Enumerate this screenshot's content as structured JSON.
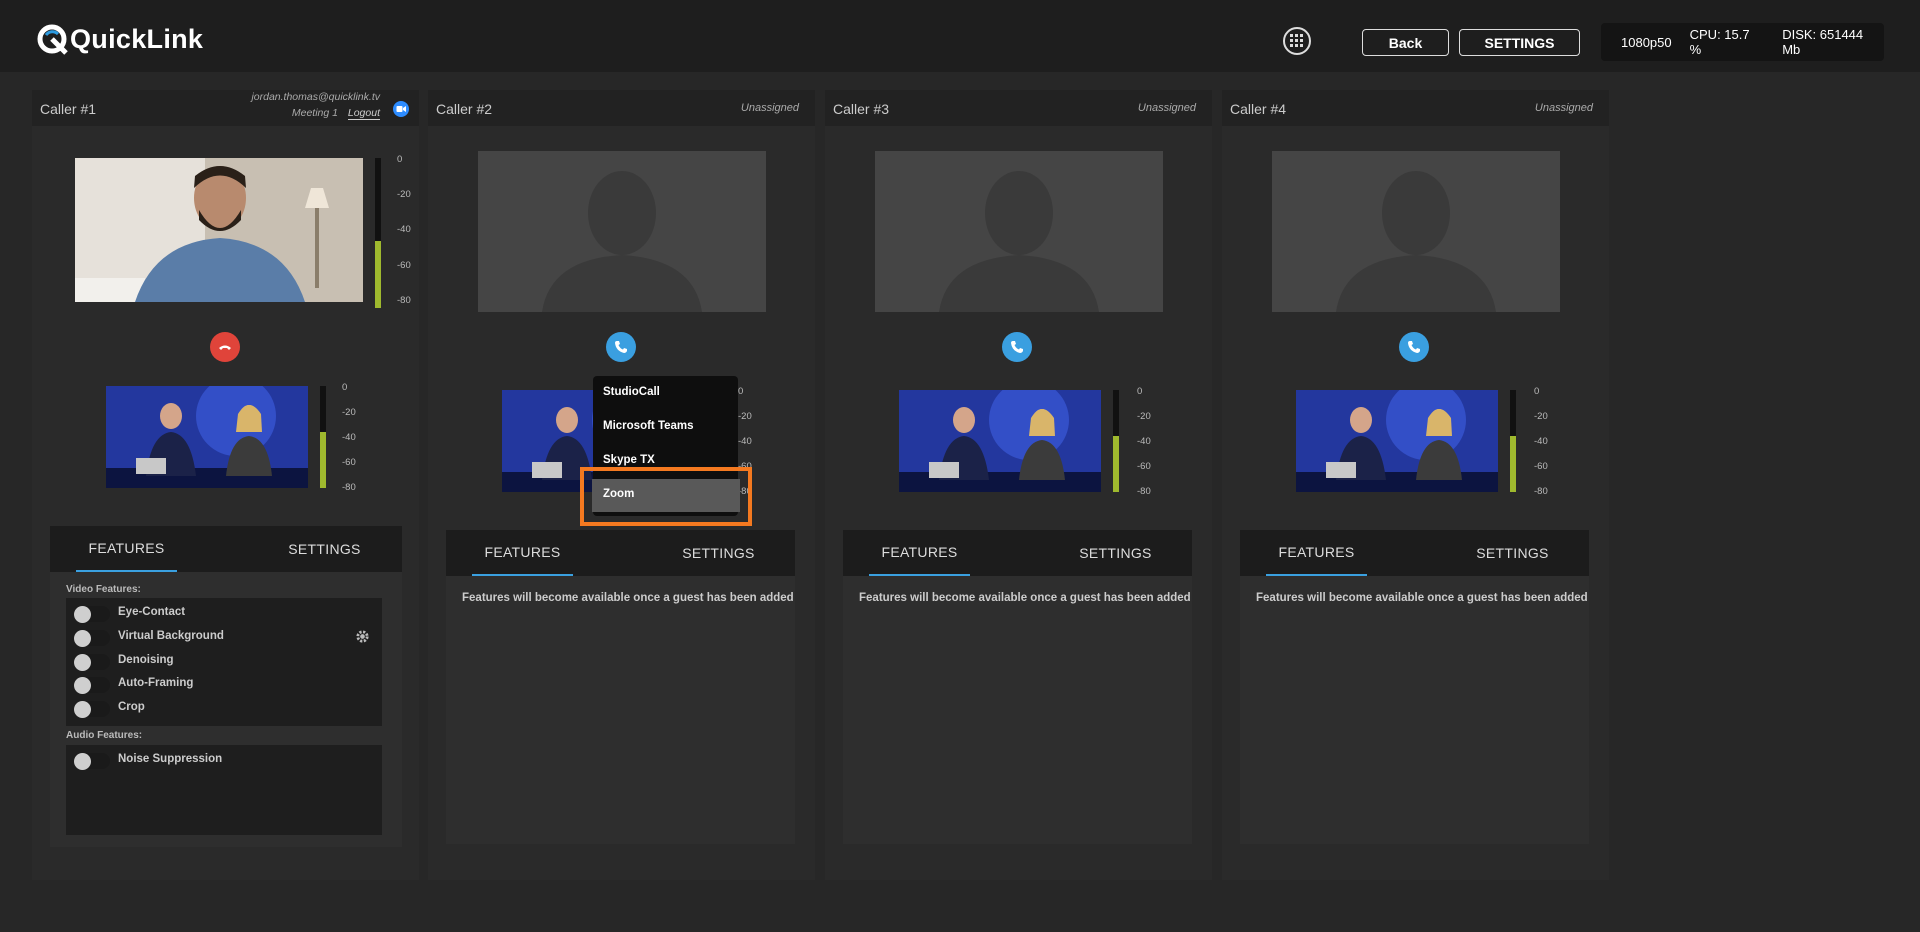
{
  "app": {
    "name": "QuickLink"
  },
  "header": {
    "back_label": "Back",
    "settings_label": "SETTINGS",
    "status": {
      "resolution": "1080p50",
      "cpu": "CPU: 15.7 %",
      "disk": "DISK: 651444 Mb"
    }
  },
  "callers": [
    {
      "name": "Caller #1",
      "email": "jordan.thomas@quicklink.tv",
      "meeting": "Meeting 1",
      "logout": "Logout",
      "status": "",
      "call_state": "active",
      "level": 0.45,
      "program_level": 0.55
    },
    {
      "name": "Caller #2",
      "status": "Unassigned",
      "call_state": "idle",
      "level": 0,
      "program_level": 0.55
    },
    {
      "name": "Caller #3",
      "status": "Unassigned",
      "call_state": "idle",
      "level": 0,
      "program_level": 0.55
    },
    {
      "name": "Caller #4",
      "status": "Unassigned",
      "call_state": "idle",
      "level": 0,
      "program_level": 0.55
    }
  ],
  "meter_scale": [
    "0",
    "-20",
    "-40",
    "-60",
    "-80"
  ],
  "tabs": {
    "features": "FEATURES",
    "settings": "SETTINGS"
  },
  "features": {
    "video_label": "Video Features:",
    "video": [
      "Eye-Contact",
      "Virtual Background",
      "Denoising",
      "Auto-Framing",
      "Crop"
    ],
    "audio_label": "Audio Features:",
    "audio": [
      "Noise Suppression"
    ],
    "empty_message": "Features will become available once a guest has been added"
  },
  "call_dropdown": {
    "items": [
      "StudioCall",
      "Microsoft Teams",
      "Skype TX",
      "Zoom"
    ],
    "selected": "Zoom"
  },
  "colors": {
    "accent": "#3aa0e0",
    "hangup": "#e0443a",
    "call": "#3a9fe0",
    "highlight": "#f47920",
    "meter": "#9fb92e"
  }
}
